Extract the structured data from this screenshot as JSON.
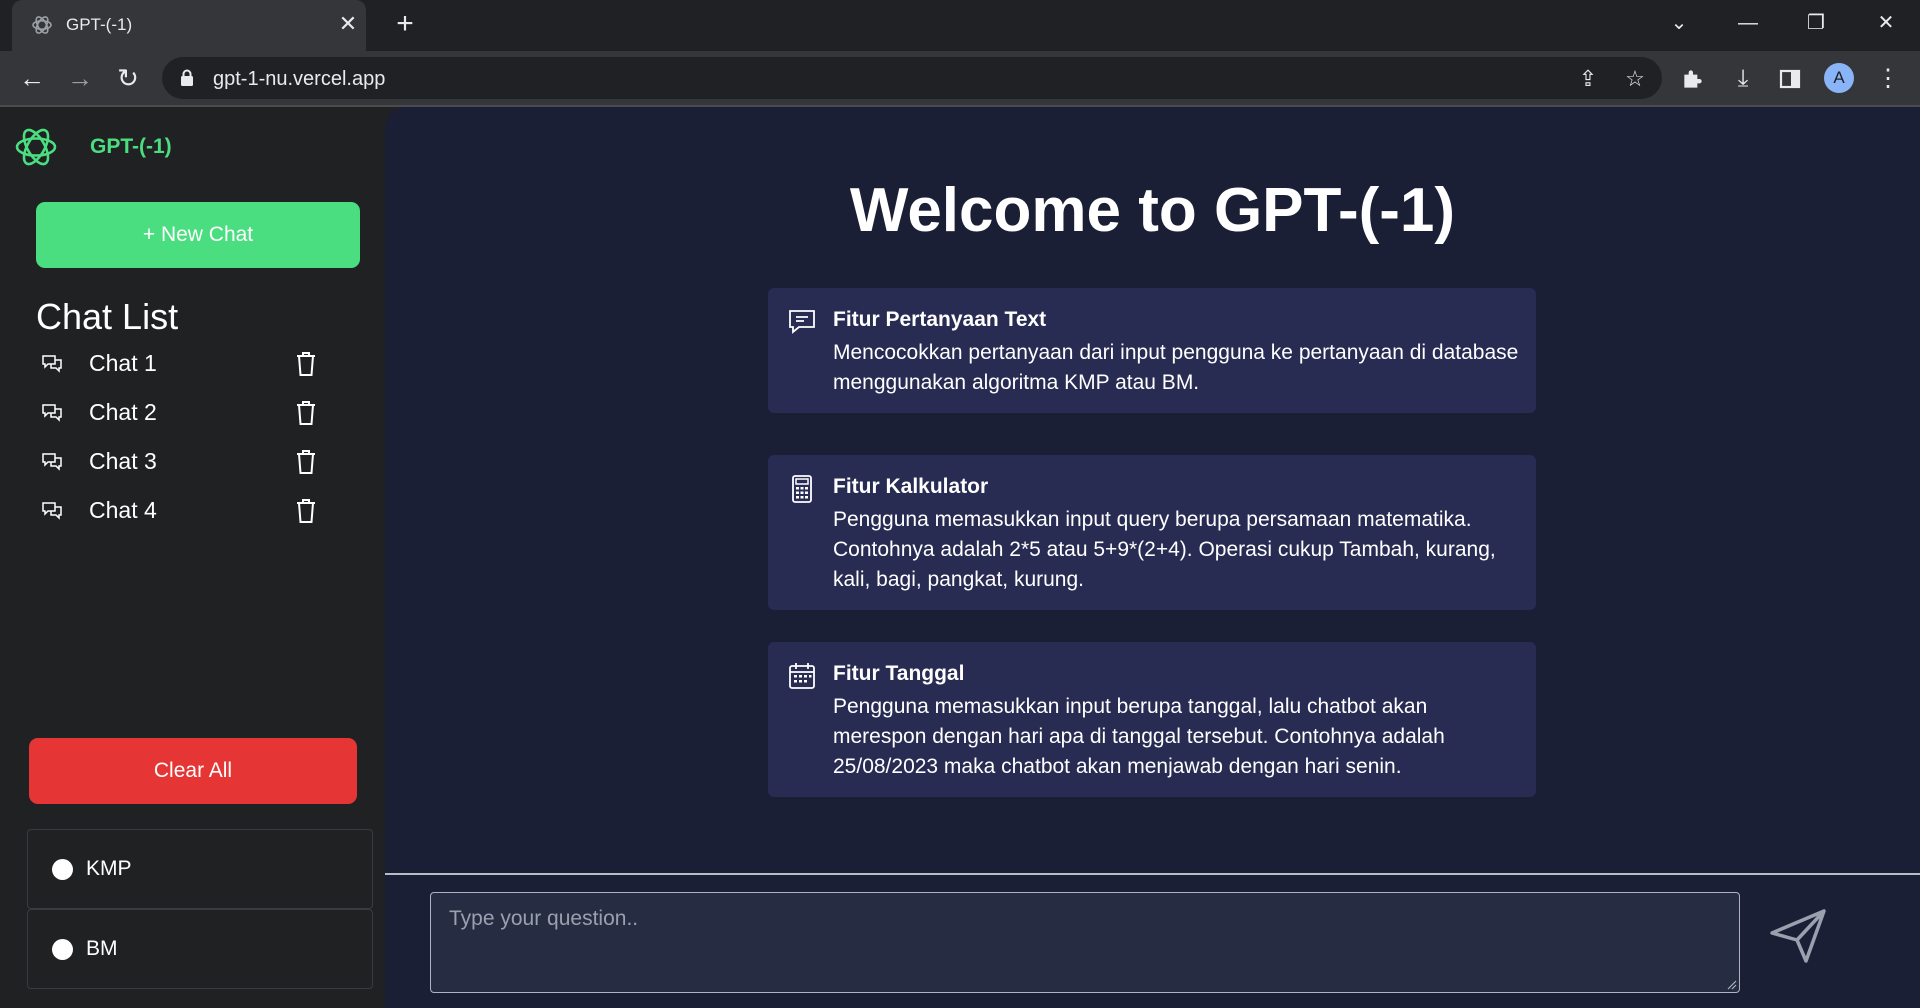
{
  "browser": {
    "tab_title": "GPT-(-1)",
    "tab_close": "✕",
    "new_tab": "+",
    "url": "gpt-1-nu.vercel.app",
    "profile_initial": "A",
    "back_glyph": "←",
    "forward_glyph": "→",
    "reload_glyph": "↻",
    "chevron_glyph": "⌄",
    "minimize_glyph": "—",
    "restore_glyph": "❐",
    "close_glyph": "✕",
    "share_glyph": "⇪",
    "star_glyph": "☆",
    "download_glyph": "⤓",
    "menu_glyph": "⋮"
  },
  "sidebar": {
    "brand": "GPT-(-1)",
    "new_chat_label": "+ New Chat",
    "chat_list_title": "Chat List",
    "chats": [
      {
        "label": "Chat 1"
      },
      {
        "label": "Chat 2"
      },
      {
        "label": "Chat 3"
      },
      {
        "label": "Chat 4"
      }
    ],
    "clear_all_label": "Clear All",
    "algorithms": [
      {
        "label": "KMP",
        "selected": false
      },
      {
        "label": "BM",
        "selected": false
      }
    ]
  },
  "main": {
    "welcome": "Welcome to GPT-(-1)",
    "features": [
      {
        "icon": "chat-bubble-icon",
        "title": "Fitur Pertanyaan Text",
        "description": "Mencocokkan pertanyaan dari input pengguna ke pertanyaan di database menggunakan algoritma KMP atau BM."
      },
      {
        "icon": "calculator-icon",
        "title": "Fitur Kalkulator",
        "description": "Pengguna memasukkan input query berupa persamaan matematika. Contohnya adalah 2*5 atau 5+9*(2+4). Operasi cukup Tambah, kurang, kali, bagi, pangkat, kurung."
      },
      {
        "icon": "calendar-icon",
        "title": "Fitur Tanggal",
        "description": "Pengguna memasukkan input berupa tanggal, lalu chatbot akan merespon dengan hari apa di tanggal tersebut. Contohnya adalah 25/08/2023 maka chatbot akan menjawab dengan hari senin."
      }
    ],
    "question_placeholder": "Type your question.."
  },
  "colors": {
    "accent_green": "#4ade80",
    "danger_red": "#e53535",
    "sidebar_bg": "#202123",
    "main_bg": "#1a1f35",
    "card_bg": "#282b52"
  }
}
